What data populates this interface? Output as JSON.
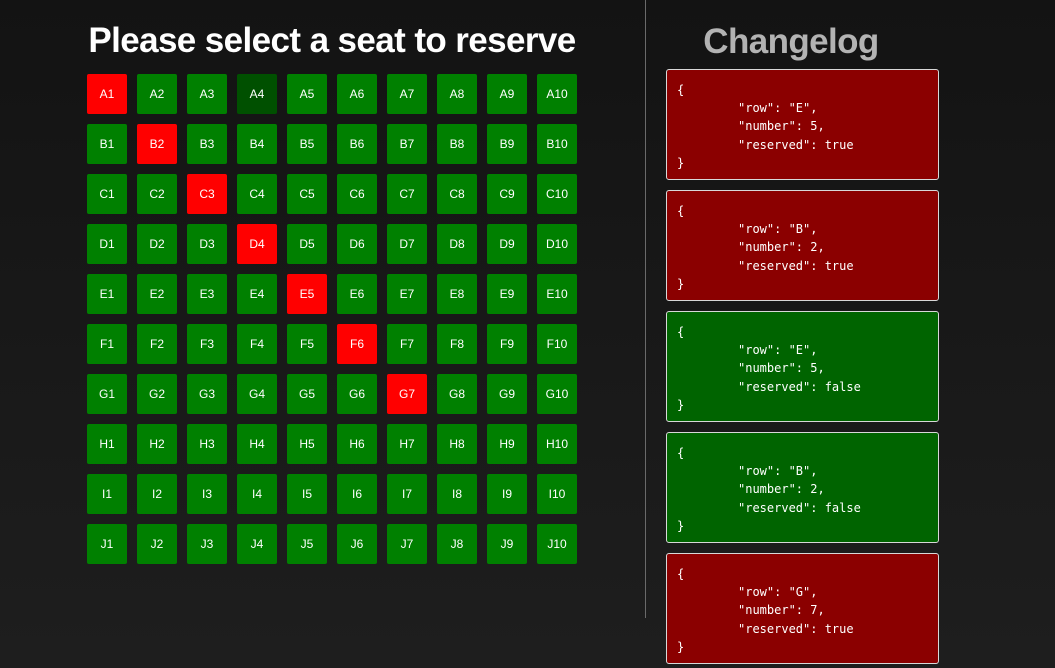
{
  "seat_panel": {
    "title": "Please select a seat to reserve",
    "colors": {
      "free": "#008000",
      "reserved": "#ff0000",
      "hovered": "#005000"
    },
    "hovered_seat": "A4",
    "rows": [
      {
        "row": "A",
        "seats": [
          {
            "label": "A1",
            "reserved": true
          },
          {
            "label": "A2",
            "reserved": false
          },
          {
            "label": "A3",
            "reserved": false
          },
          {
            "label": "A4",
            "reserved": false
          },
          {
            "label": "A5",
            "reserved": false
          },
          {
            "label": "A6",
            "reserved": false
          },
          {
            "label": "A7",
            "reserved": false
          },
          {
            "label": "A8",
            "reserved": false
          },
          {
            "label": "A9",
            "reserved": false
          },
          {
            "label": "A10",
            "reserved": false
          }
        ]
      },
      {
        "row": "B",
        "seats": [
          {
            "label": "B1",
            "reserved": false
          },
          {
            "label": "B2",
            "reserved": true
          },
          {
            "label": "B3",
            "reserved": false
          },
          {
            "label": "B4",
            "reserved": false
          },
          {
            "label": "B5",
            "reserved": false
          },
          {
            "label": "B6",
            "reserved": false
          },
          {
            "label": "B7",
            "reserved": false
          },
          {
            "label": "B8",
            "reserved": false
          },
          {
            "label": "B9",
            "reserved": false
          },
          {
            "label": "B10",
            "reserved": false
          }
        ]
      },
      {
        "row": "C",
        "seats": [
          {
            "label": "C1",
            "reserved": false
          },
          {
            "label": "C2",
            "reserved": false
          },
          {
            "label": "C3",
            "reserved": true
          },
          {
            "label": "C4",
            "reserved": false
          },
          {
            "label": "C5",
            "reserved": false
          },
          {
            "label": "C6",
            "reserved": false
          },
          {
            "label": "C7",
            "reserved": false
          },
          {
            "label": "C8",
            "reserved": false
          },
          {
            "label": "C9",
            "reserved": false
          },
          {
            "label": "C10",
            "reserved": false
          }
        ]
      },
      {
        "row": "D",
        "seats": [
          {
            "label": "D1",
            "reserved": false
          },
          {
            "label": "D2",
            "reserved": false
          },
          {
            "label": "D3",
            "reserved": false
          },
          {
            "label": "D4",
            "reserved": true
          },
          {
            "label": "D5",
            "reserved": false
          },
          {
            "label": "D6",
            "reserved": false
          },
          {
            "label": "D7",
            "reserved": false
          },
          {
            "label": "D8",
            "reserved": false
          },
          {
            "label": "D9",
            "reserved": false
          },
          {
            "label": "D10",
            "reserved": false
          }
        ]
      },
      {
        "row": "E",
        "seats": [
          {
            "label": "E1",
            "reserved": false
          },
          {
            "label": "E2",
            "reserved": false
          },
          {
            "label": "E3",
            "reserved": false
          },
          {
            "label": "E4",
            "reserved": false
          },
          {
            "label": "E5",
            "reserved": true
          },
          {
            "label": "E6",
            "reserved": false
          },
          {
            "label": "E7",
            "reserved": false
          },
          {
            "label": "E8",
            "reserved": false
          },
          {
            "label": "E9",
            "reserved": false
          },
          {
            "label": "E10",
            "reserved": false
          }
        ]
      },
      {
        "row": "F",
        "seats": [
          {
            "label": "F1",
            "reserved": false
          },
          {
            "label": "F2",
            "reserved": false
          },
          {
            "label": "F3",
            "reserved": false
          },
          {
            "label": "F4",
            "reserved": false
          },
          {
            "label": "F5",
            "reserved": false
          },
          {
            "label": "F6",
            "reserved": true
          },
          {
            "label": "F7",
            "reserved": false
          },
          {
            "label": "F8",
            "reserved": false
          },
          {
            "label": "F9",
            "reserved": false
          },
          {
            "label": "F10",
            "reserved": false
          }
        ]
      },
      {
        "row": "G",
        "seats": [
          {
            "label": "G1",
            "reserved": false
          },
          {
            "label": "G2",
            "reserved": false
          },
          {
            "label": "G3",
            "reserved": false
          },
          {
            "label": "G4",
            "reserved": false
          },
          {
            "label": "G5",
            "reserved": false
          },
          {
            "label": "G6",
            "reserved": false
          },
          {
            "label": "G7",
            "reserved": true
          },
          {
            "label": "G8",
            "reserved": false
          },
          {
            "label": "G9",
            "reserved": false
          },
          {
            "label": "G10",
            "reserved": false
          }
        ]
      },
      {
        "row": "H",
        "seats": [
          {
            "label": "H1",
            "reserved": false
          },
          {
            "label": "H2",
            "reserved": false
          },
          {
            "label": "H3",
            "reserved": false
          },
          {
            "label": "H4",
            "reserved": false
          },
          {
            "label": "H5",
            "reserved": false
          },
          {
            "label": "H6",
            "reserved": false
          },
          {
            "label": "H7",
            "reserved": false
          },
          {
            "label": "H8",
            "reserved": false
          },
          {
            "label": "H9",
            "reserved": false
          },
          {
            "label": "H10",
            "reserved": false
          }
        ]
      },
      {
        "row": "I",
        "seats": [
          {
            "label": "I1",
            "reserved": false
          },
          {
            "label": "I2",
            "reserved": false
          },
          {
            "label": "I3",
            "reserved": false
          },
          {
            "label": "I4",
            "reserved": false
          },
          {
            "label": "I5",
            "reserved": false
          },
          {
            "label": "I6",
            "reserved": false
          },
          {
            "label": "I7",
            "reserved": false
          },
          {
            "label": "I8",
            "reserved": false
          },
          {
            "label": "I9",
            "reserved": false
          },
          {
            "label": "I10",
            "reserved": false
          }
        ]
      },
      {
        "row": "J",
        "seats": [
          {
            "label": "J1",
            "reserved": false
          },
          {
            "label": "J2",
            "reserved": false
          },
          {
            "label": "J3",
            "reserved": false
          },
          {
            "label": "J4",
            "reserved": false
          },
          {
            "label": "J5",
            "reserved": false
          },
          {
            "label": "J6",
            "reserved": false
          },
          {
            "label": "J7",
            "reserved": false
          },
          {
            "label": "J8",
            "reserved": false
          },
          {
            "label": "J9",
            "reserved": false
          },
          {
            "label": "J10",
            "reserved": false
          }
        ]
      }
    ]
  },
  "changelog": {
    "title": "Changelog",
    "colors": {
      "reserved_true": "#8b0000",
      "reserved_false": "#006400"
    },
    "entries": [
      {
        "open": "{",
        "row_line": "\"row\": \"E\",",
        "number_line": "\"number\": 5,",
        "reserved_line": "\"reserved\": true",
        "close": "}",
        "reserved": true
      },
      {
        "open": "{",
        "row_line": "\"row\": \"B\",",
        "number_line": "\"number\": 2,",
        "reserved_line": "\"reserved\": true",
        "close": "}",
        "reserved": true
      },
      {
        "open": "{",
        "row_line": "\"row\": \"E\",",
        "number_line": "\"number\": 5,",
        "reserved_line": "\"reserved\": false",
        "close": "}",
        "reserved": false
      },
      {
        "open": "{",
        "row_line": "\"row\": \"B\",",
        "number_line": "\"number\": 2,",
        "reserved_line": "\"reserved\": false",
        "close": "}",
        "reserved": false
      },
      {
        "open": "{",
        "row_line": "\"row\": \"G\",",
        "number_line": "\"number\": 7,",
        "reserved_line": "\"reserved\": true",
        "close": "}",
        "reserved": true
      }
    ]
  }
}
